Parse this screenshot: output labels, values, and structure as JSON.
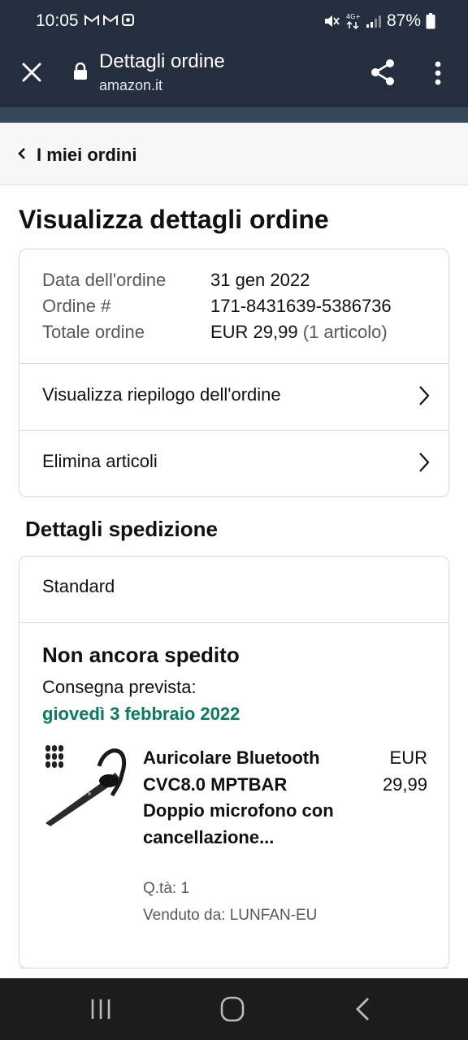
{
  "status_bar": {
    "time": "10:05",
    "network": "4G+",
    "battery": "87%",
    "left_icons": [
      "gmail-icon",
      "gmail-icon",
      "clock-app-icon"
    ],
    "right_icons": [
      "mute-icon",
      "data-arrows-icon",
      "signal-icon",
      "battery-icon"
    ]
  },
  "browser": {
    "title": "Dettagli ordine",
    "domain": "amazon.it"
  },
  "breadcrumb": {
    "label": "I miei ordini"
  },
  "page": {
    "title": "Visualizza dettagli ordine"
  },
  "order_info": {
    "rows": [
      {
        "key": "Data dell'ordine",
        "value": "31 gen 2022"
      },
      {
        "key": "Ordine #",
        "value": "171-8431639-5386736"
      },
      {
        "key": "Totale ordine",
        "value": "EUR 29,99",
        "extra": "(1 articolo)"
      }
    ],
    "links": [
      {
        "label": "Visualizza riepilogo dell'ordine"
      },
      {
        "label": "Elimina articoli"
      }
    ]
  },
  "shipping": {
    "section_title": "Dettagli spedizione",
    "method": "Standard",
    "status": "Non ancora spedito",
    "delivery_label": "Consegna prevista:",
    "delivery_date": "giovedì 3 febbraio 2022",
    "product": {
      "title": "Auricolare Bluetooth CVC8.0 MPTBAR Doppio microfono con cancellazione...",
      "price_currency": "EUR",
      "price_amount": "29,99",
      "quantity": "Q.tà: 1",
      "seller": "Venduto da: LUNFAN-EU"
    }
  },
  "colors": {
    "header_bg": "#232f3e",
    "nav_strip": "#37475a",
    "delivery_green": "#067d62",
    "muted_text": "#565959",
    "border": "#d5d9d9"
  }
}
